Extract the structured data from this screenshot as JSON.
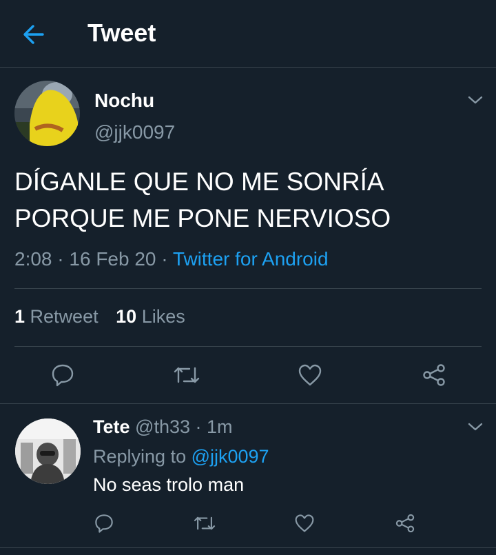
{
  "header": {
    "title": "Tweet"
  },
  "tweet": {
    "display_name": "Nochu",
    "handle": "@jjk0097",
    "text_line1": "DÍGANLE QUE NO ME SONRÍA",
    "text_line2": "PORQUE ME PONE NERVIOSO",
    "time": "2:08",
    "sep1": " · ",
    "date": "16 Feb 20",
    "sep2": " · ",
    "source": "Twitter for Android",
    "retweet_count": "1",
    "retweet_label": "Retweet",
    "like_count": "10",
    "like_label": "Likes"
  },
  "reply": {
    "display_name": "Tete",
    "handle": "@th33",
    "sep": " · ",
    "time": "1m",
    "replying_label": "Replying to ",
    "replying_handle": "@jjk0097",
    "text": "No seas trolo man"
  },
  "icons": {
    "back": "arrow-left-icon",
    "more": "chevron-down-icon",
    "reply": "comment-icon",
    "retweet": "retweet-icon",
    "like": "heart-icon",
    "share": "share-icon"
  },
  "colors": {
    "background": "#15202b",
    "accent": "#1da1f2",
    "secondary_text": "#8899a6",
    "divider": "#38444d"
  }
}
